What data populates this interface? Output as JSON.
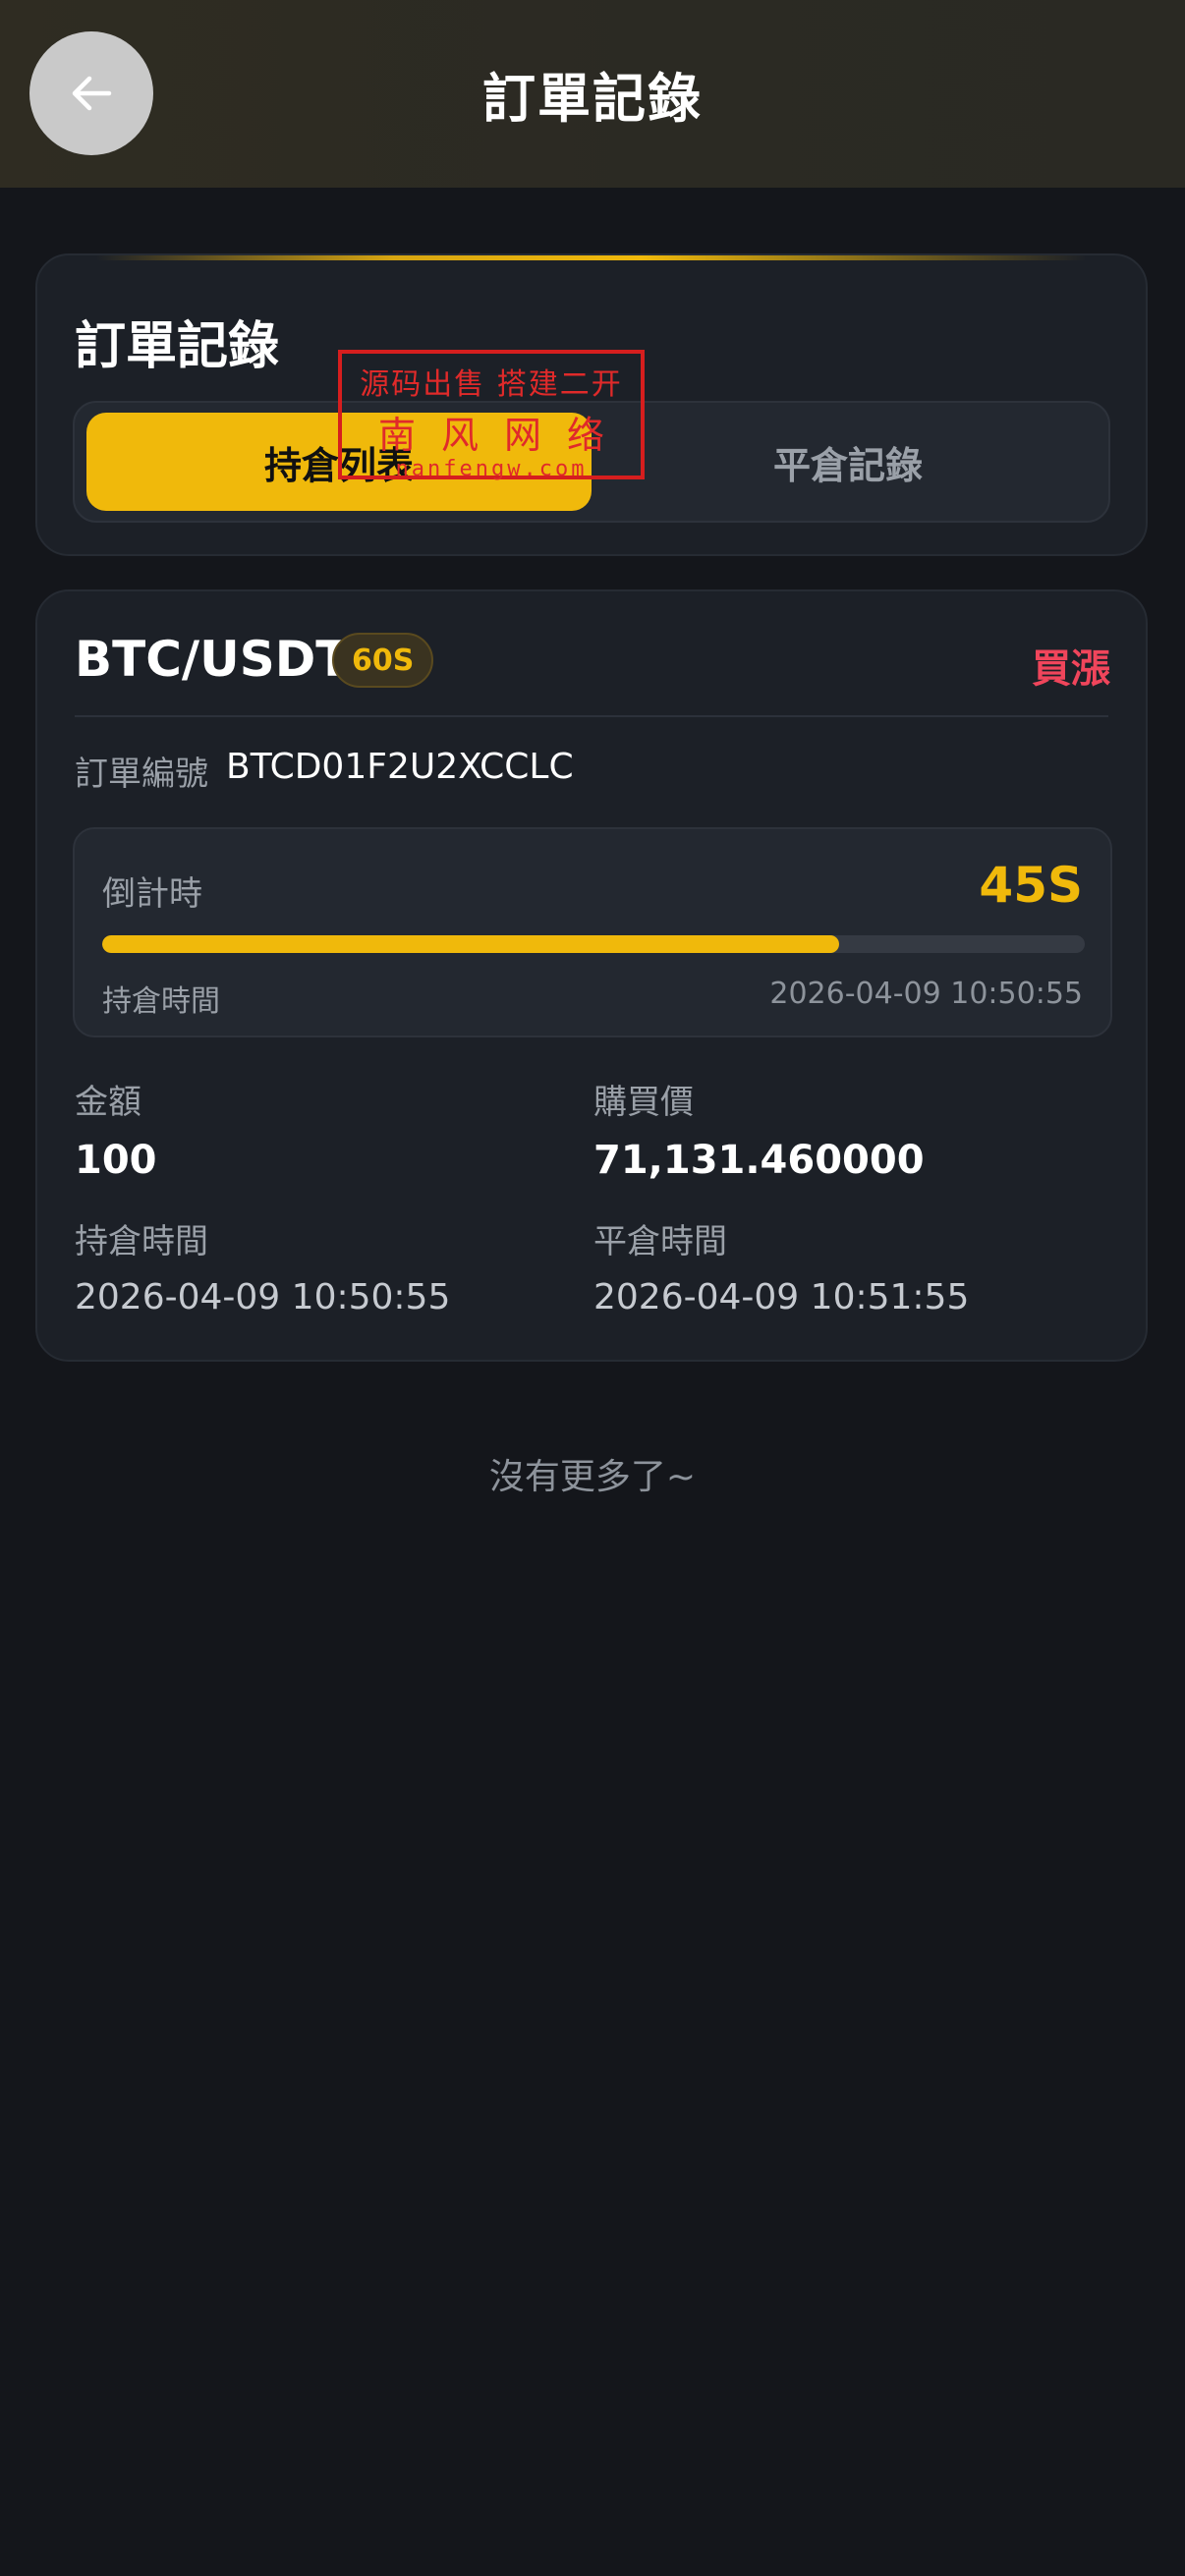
{
  "header": {
    "title": "訂單記錄",
    "back_icon": "arrow-left-icon"
  },
  "orders_section": {
    "title": "訂單記錄",
    "tabs": [
      {
        "label": "持倉列表",
        "active": true
      },
      {
        "label": "平倉記錄",
        "active": false
      }
    ]
  },
  "watermark": {
    "line1": "源码出售 搭建二开",
    "line2": "南风网络",
    "line3": "nanfengw.com"
  },
  "order": {
    "pair": "BTC/USDT",
    "period": "60S",
    "direction": "買漲",
    "order_no_label": "訂單編號",
    "order_no": "BTCD01F2U2XCCLC",
    "countdown_label": "倒計時",
    "countdown_value": "45S",
    "countdown_fraction": 0.75,
    "hold_time_label": "持倉時間",
    "hold_time": "2026-04-09 10:50:55",
    "amount_label": "金額",
    "amount": "100",
    "buy_price_label": "購買價",
    "buy_price": "71,131.460000",
    "open_time_label": "持倉時間",
    "open_time": "2026-04-09 10:50:55",
    "close_time_label": "平倉時間",
    "close_time": "2026-04-09 10:51:55"
  },
  "footer": {
    "no_more": "沒有更多了~"
  },
  "colors": {
    "accent": "#f0b90b",
    "buy_up": "#f0455b",
    "background": "#14161b",
    "card": "#1c2027"
  }
}
